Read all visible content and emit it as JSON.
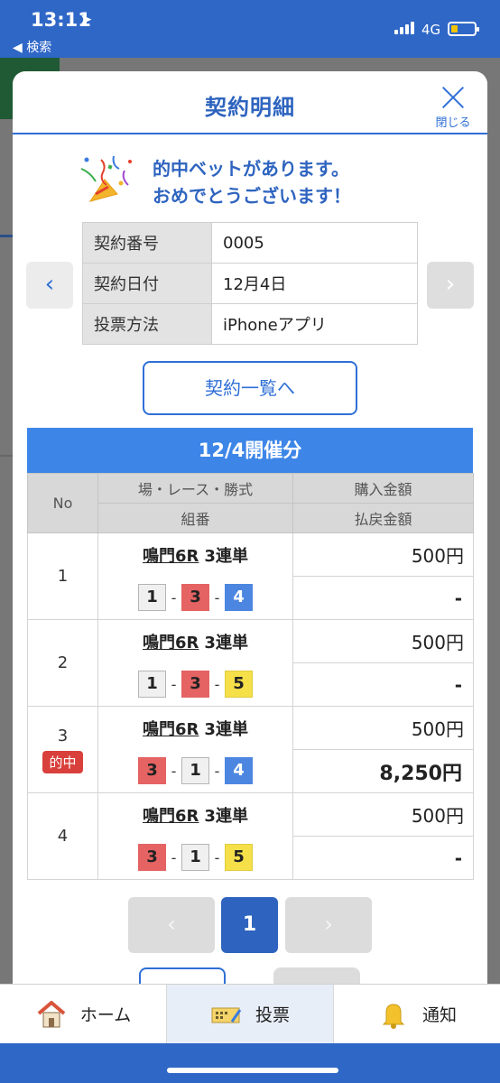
{
  "status_bar": {
    "time": "13:11",
    "location_icon": "location-arrow-icon",
    "back_label": "◀ 検索",
    "network": "4G",
    "battery_color": "#f2c400"
  },
  "modal": {
    "title": "契約明細",
    "close_label": "閉じる"
  },
  "congrats": {
    "line1": "的中ベットがあります。",
    "line2": "おめでとうございます！",
    "icon": "party-popper-icon"
  },
  "contract": {
    "rows": [
      {
        "label": "契約番号",
        "value": "0005"
      },
      {
        "label": "契約日付",
        "value": "12月4日"
      },
      {
        "label": "投票方法",
        "value": "iPhoneアプリ"
      }
    ],
    "prev_symbol": "‹",
    "next_symbol": "›"
  },
  "list_button": "契約一覧へ",
  "section_title": "12/4開催分",
  "table": {
    "headers": {
      "no": "No",
      "race": "場・レース・勝式",
      "combo": "組番",
      "purchase": "購入金額",
      "payout": "払戻金額"
    },
    "rows": [
      {
        "no": "1",
        "venue": "鳴門6R",
        "bet_type": "3連単",
        "combo": [
          "1",
          "3",
          "4"
        ],
        "purchase": "500円",
        "payout": "-",
        "hit": ""
      },
      {
        "no": "2",
        "venue": "鳴門6R",
        "bet_type": "3連単",
        "combo": [
          "1",
          "3",
          "5"
        ],
        "purchase": "500円",
        "payout": "-",
        "hit": ""
      },
      {
        "no": "3",
        "venue": "鳴門6R",
        "bet_type": "3連単",
        "combo": [
          "3",
          "1",
          "4"
        ],
        "purchase": "500円",
        "payout": "8,250円",
        "hit": "的中"
      },
      {
        "no": "4",
        "venue": "鳴門6R",
        "bet_type": "3連単",
        "combo": [
          "3",
          "1",
          "5"
        ],
        "purchase": "500円",
        "payout": "-",
        "hit": ""
      }
    ],
    "combo_separator": "-",
    "boat_colors": {
      "1": "#f0f0f0",
      "3": "#e56363",
      "4": "#4c86e0",
      "5": "#f5e04a"
    }
  },
  "pagination": {
    "prev_symbol": "‹",
    "current": "1",
    "next_symbol": "›"
  },
  "tabbar": {
    "tabs": [
      {
        "label": "ホーム",
        "icon": "house-icon"
      },
      {
        "label": "投票",
        "icon": "ticket-pen-icon"
      },
      {
        "label": "通知",
        "icon": "bell-icon"
      }
    ]
  },
  "colors": {
    "primary": "#2f67c7",
    "accent_blue": "#2f6fd6",
    "hit_red": "#d9403c"
  }
}
